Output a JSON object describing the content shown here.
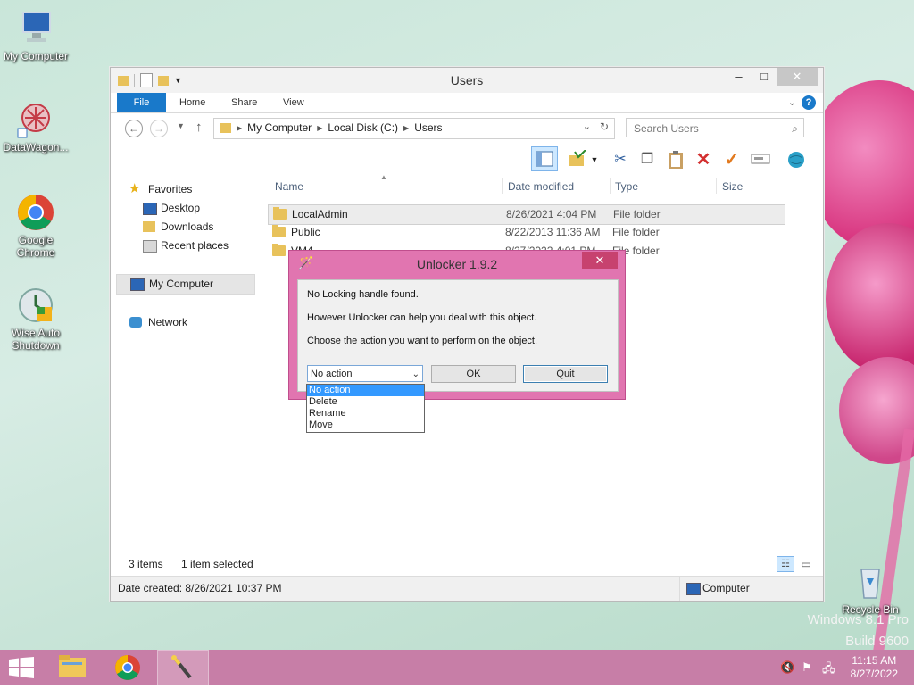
{
  "desktop": {
    "icons": [
      {
        "label": "My Computer"
      },
      {
        "label": "DataWagon..."
      },
      {
        "label": "Google Chrome"
      },
      {
        "label": "Wise Auto Shutdown"
      },
      {
        "label": "Recycle Bin"
      }
    ],
    "watermark_line1": "Windows 8.1 Pro",
    "watermark_line2": "Build 9600"
  },
  "explorer": {
    "title": "Users",
    "ribbon_tabs": [
      "File",
      "Home",
      "Share",
      "View"
    ],
    "breadcrumb": [
      "My Computer",
      "Local Disk (C:)",
      "Users"
    ],
    "search_placeholder": "Search Users",
    "nav": {
      "favorites": "Favorites",
      "desktop": "Desktop",
      "downloads": "Downloads",
      "recent": "Recent places",
      "computer": "My Computer",
      "network": "Network"
    },
    "columns": [
      "Name",
      "Date modified",
      "Type",
      "Size"
    ],
    "rows": [
      {
        "name": "LocalAdmin",
        "date": "8/26/2021 4:04 PM",
        "type": "File folder",
        "size": ""
      },
      {
        "name": "Public",
        "date": "8/22/2013 11:36 AM",
        "type": "File folder",
        "size": ""
      },
      {
        "name": "VM4",
        "date": "8/27/2022 4:01 PM",
        "type": "File folder",
        "size": ""
      }
    ],
    "status_items": "3 items",
    "status_selected": "1 item selected",
    "details_created": "Date created: 8/26/2021 10:37 PM",
    "details_location": "Computer"
  },
  "dialog": {
    "title": "Unlocker 1.9.2",
    "line1": "No Locking handle found.",
    "line2": "However Unlocker can help you deal with this object.",
    "line3": "Choose the action you want to perform on the object.",
    "selected_action": "No action",
    "actions": [
      "No action",
      "Delete",
      "Rename",
      "Move"
    ],
    "ok_label": "OK",
    "quit_label": "Quit"
  },
  "taskbar": {
    "time": "11:15 AM",
    "date": "8/27/2022"
  }
}
